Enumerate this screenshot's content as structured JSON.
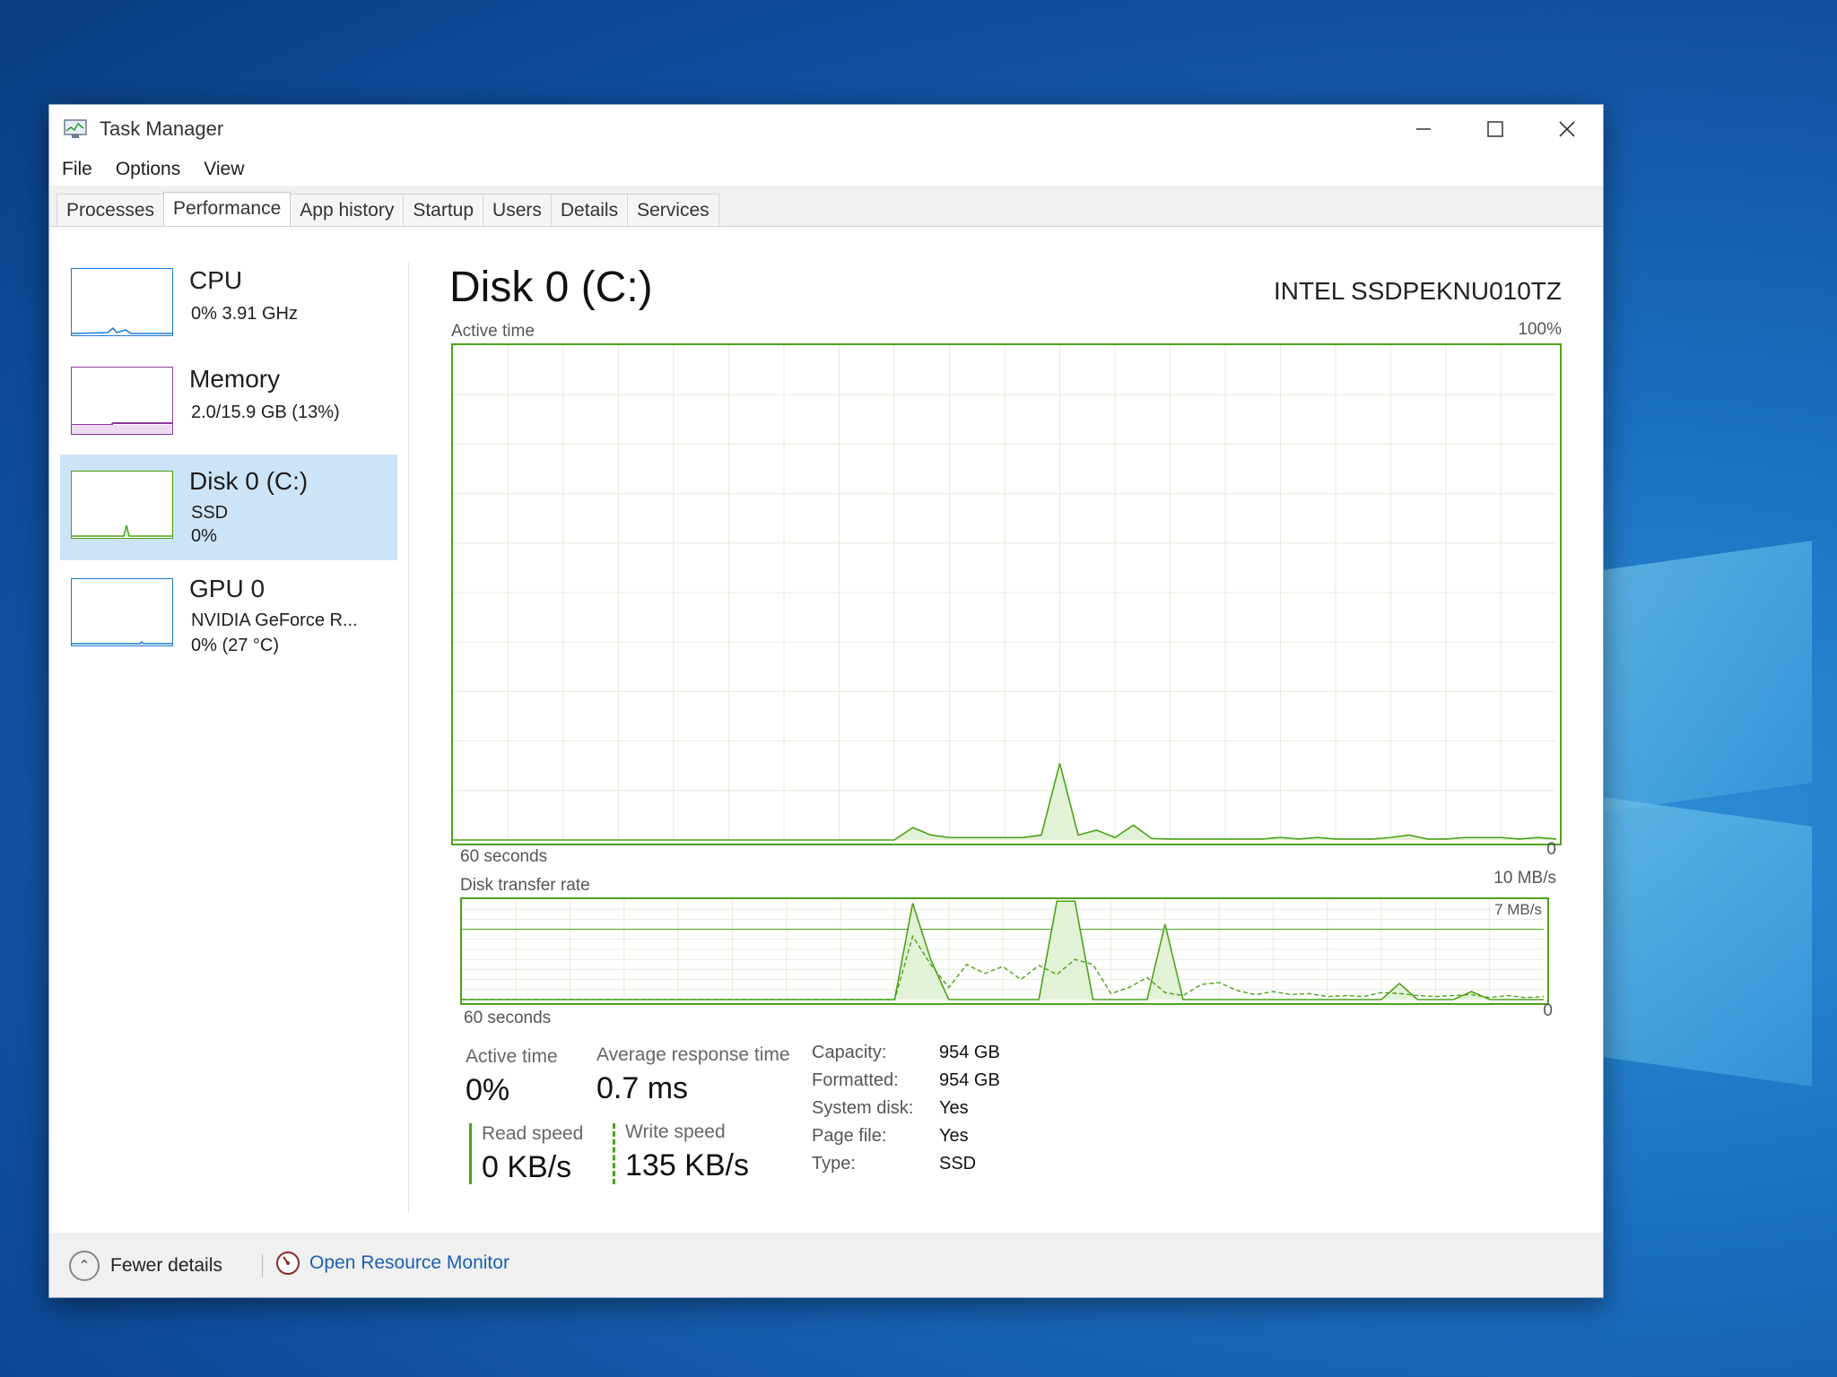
{
  "window": {
    "title": "Task Manager"
  },
  "menu": [
    "File",
    "Options",
    "View"
  ],
  "tabs": [
    "Processes",
    "Performance",
    "App history",
    "Startup",
    "Users",
    "Details",
    "Services"
  ],
  "active_tab": "Performance",
  "sidebar": [
    {
      "title": "CPU",
      "line1": "0% 3.91 GHz",
      "line2": ""
    },
    {
      "title": "Memory",
      "line1": "2.0/15.9 GB (13%)",
      "line2": ""
    },
    {
      "title": "Disk 0 (C:)",
      "line1": "SSD",
      "line2": "0%"
    },
    {
      "title": "GPU 0",
      "line1": "NVIDIA GeForce R...",
      "line2": "0% (27 °C)"
    }
  ],
  "disk": {
    "title": "Disk 0 (C:)",
    "model": "INTEL SSDPEKNU010TZ",
    "active_time_label": "Active time",
    "active_max": "100%",
    "seconds_label": "60 seconds",
    "zero": "0",
    "transfer_label": "Disk transfer rate",
    "transfer_max": "10 MB/s",
    "transfer_mid": "7 MB/s"
  },
  "stats": {
    "active_time": {
      "label": "Active time",
      "value": "0%"
    },
    "avg_response": {
      "label": "Average response time",
      "value": "0.7 ms"
    },
    "read_speed": {
      "label": "Read speed",
      "value": "0 KB/s"
    },
    "write_speed": {
      "label": "Write speed",
      "value": "135 KB/s"
    }
  },
  "properties": [
    {
      "label": "Capacity:",
      "value": "954 GB"
    },
    {
      "label": "Formatted:",
      "value": "954 GB"
    },
    {
      "label": "System disk:",
      "value": "Yes"
    },
    {
      "label": "Page file:",
      "value": "Yes"
    },
    {
      "label": "Type:",
      "value": "SSD"
    }
  ],
  "footer": {
    "fewer_details": "Fewer details",
    "resource_monitor": "Open Resource Monitor"
  },
  "colors": {
    "disk_green": "#4da11a",
    "selected_bg": "#cce4f7",
    "link": "#1a5fb4",
    "memory_purple": "#8b3a9c",
    "cpu_blue": "#1b7ad6"
  },
  "chart_data": [
    {
      "type": "area",
      "title": "Active time",
      "x_range": [
        60,
        0
      ],
      "ylim": [
        0,
        100
      ],
      "y_unit": "%",
      "values": [
        0,
        0,
        0,
        0,
        0,
        0,
        0,
        0,
        0,
        0,
        0,
        0,
        0,
        0,
        0,
        0,
        0,
        0,
        0,
        0,
        0,
        0,
        0,
        0,
        0,
        2.5,
        1,
        0.5,
        0.5,
        0.5,
        0.5,
        0.5,
        1,
        15.5,
        1,
        2,
        0.5,
        3,
        0.3,
        0.2,
        0.2,
        0.2,
        0.2,
        0.2,
        0.2,
        0.5,
        0.2,
        0.5,
        0.2,
        0.2,
        0.2,
        0.5,
        1,
        0.2,
        0.2,
        0.5,
        0.5,
        0.5,
        0.2,
        0.5,
        0.2
      ]
    },
    {
      "type": "line",
      "title": "Disk transfer rate",
      "x_range": [
        60,
        0
      ],
      "ylim": [
        0,
        10
      ],
      "y_unit": "MB/s",
      "series": [
        {
          "name": "Read speed",
          "values": [
            0,
            0,
            0,
            0,
            0,
            0,
            0,
            0,
            0,
            0,
            0,
            0,
            0,
            0,
            0,
            0,
            0,
            0,
            0,
            0,
            0,
            0,
            0,
            0,
            0,
            9.6,
            4,
            0,
            0,
            0,
            0,
            0,
            0,
            9.8,
            9.8,
            0,
            0,
            0,
            0,
            7.5,
            0,
            0,
            0,
            0,
            0,
            0,
            0,
            0,
            0,
            0,
            0,
            0,
            1.6,
            0,
            0,
            0,
            0.8,
            0,
            0,
            0,
            0
          ]
        },
        {
          "name": "Write speed",
          "values": [
            0,
            0,
            0,
            0,
            0,
            0,
            0,
            0,
            0,
            0,
            0,
            0,
            0,
            0,
            0,
            0,
            0,
            0,
            0,
            0,
            0,
            0,
            0,
            0,
            0,
            6.3,
            3.5,
            1.2,
            3.5,
            2.6,
            3.3,
            2,
            3.4,
            2.5,
            4,
            3.5,
            0.6,
            1.2,
            2.2,
            0.7,
            0.4,
            1.5,
            1.7,
            0.9,
            0.5,
            0.8,
            0.5,
            0.6,
            0.3,
            0.4,
            0.3,
            0.7,
            0.6,
            0.4,
            0.3,
            0.4,
            0.5,
            0.2,
            0.4,
            0.2,
            0.3
          ]
        }
      ]
    }
  ]
}
